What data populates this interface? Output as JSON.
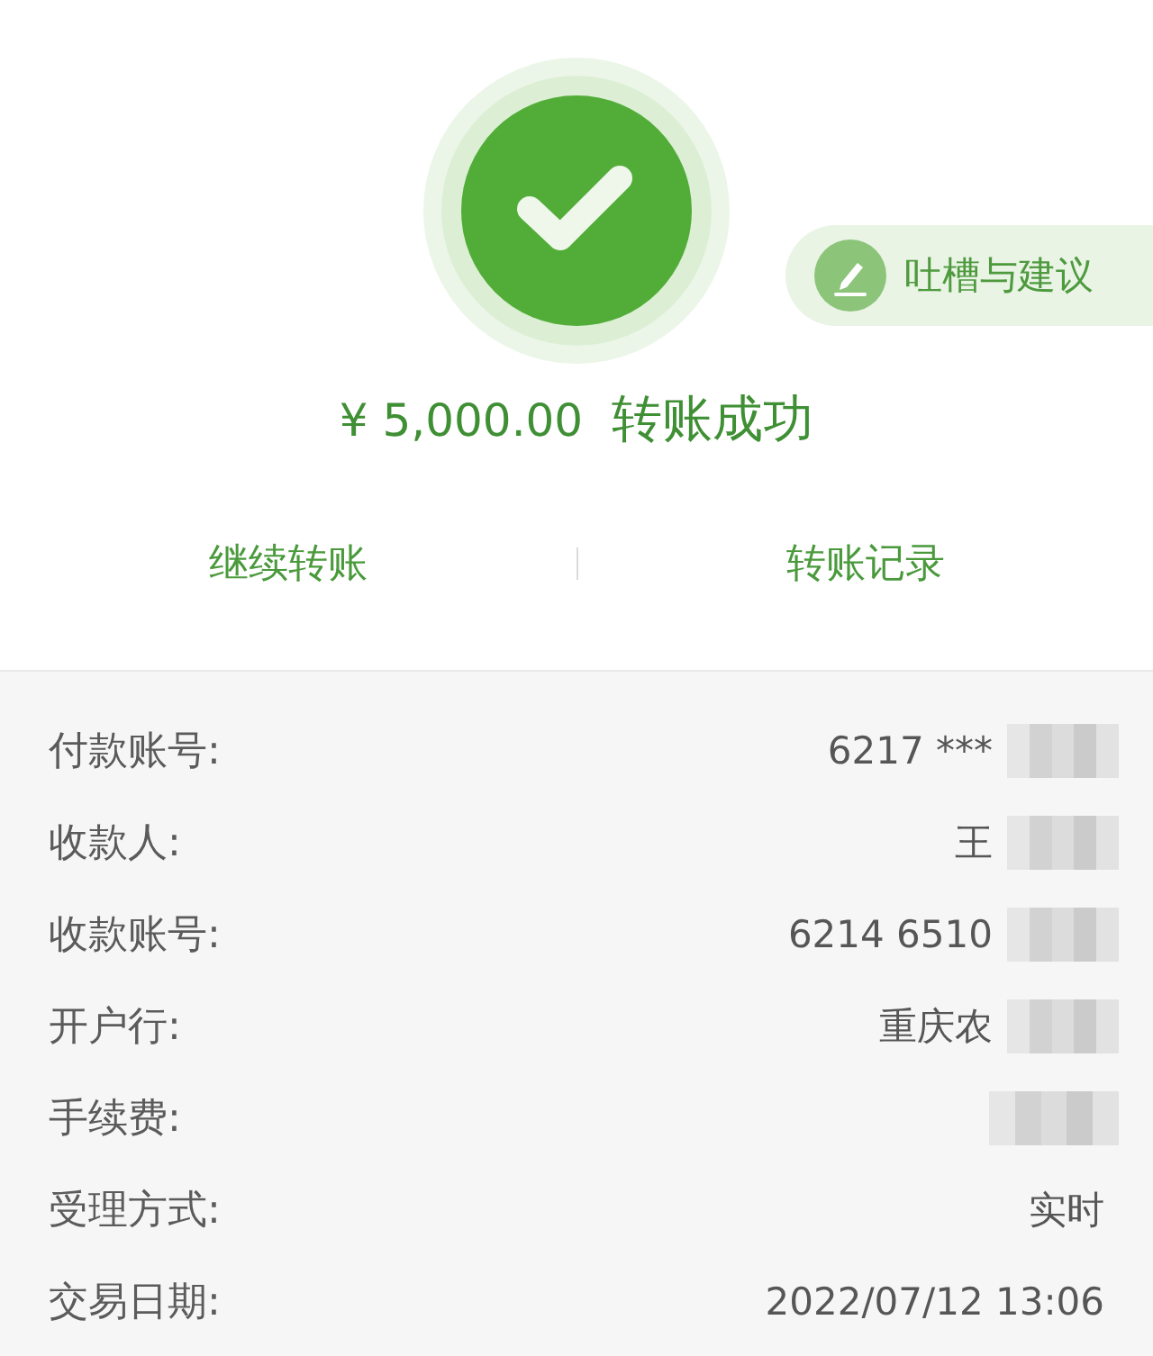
{
  "result": {
    "amount": "¥ 5,000.00",
    "status": "转账成功"
  },
  "feedback_button": {
    "label": "吐槽与建议"
  },
  "actions": [
    {
      "label": "继续转账"
    },
    {
      "label": "转账记录"
    }
  ],
  "details": [
    {
      "label": "付款账号:",
      "value": "6217 ***",
      "redacted": true
    },
    {
      "label": "收款人:",
      "value": "王",
      "redacted": true
    },
    {
      "label": "收款账号:",
      "value": "6214 6510",
      "redacted": true
    },
    {
      "label": "开户行:",
      "value": "重庆农",
      "redacted": true
    },
    {
      "label": "手续费:",
      "redacted": true
    },
    {
      "label": "受理方式:",
      "value": "实时",
      "redacted": false
    },
    {
      "label": "交易日期:",
      "value": "2022/07/12 13:06",
      "redacted": false
    }
  ]
}
